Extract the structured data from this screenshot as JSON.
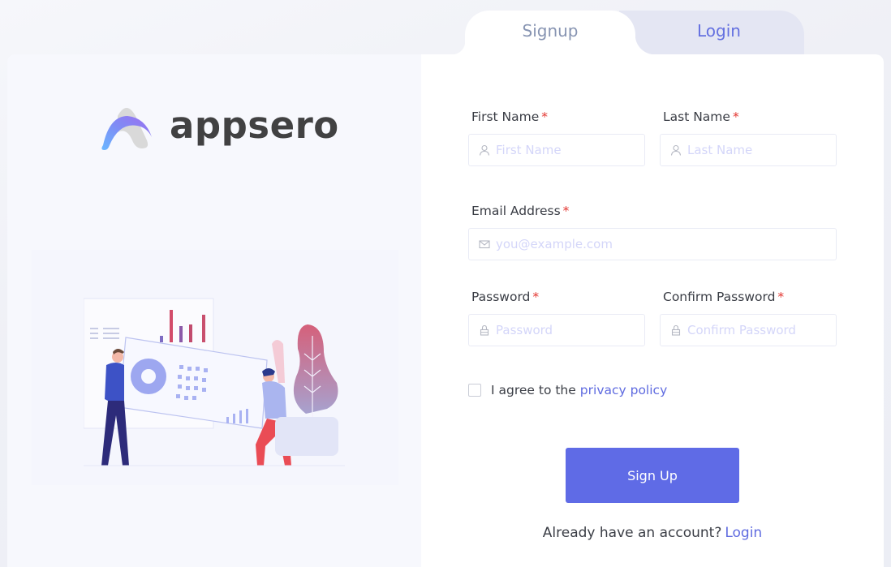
{
  "tabs": {
    "signup": "Signup",
    "login": "Login",
    "active": "Signup"
  },
  "brand": {
    "name": "appsero",
    "logo_icon": "appsero-arc-logo"
  },
  "illustration": {
    "description": "two-people-holding-dashboard-illustration"
  },
  "form": {
    "first_name": {
      "label": "First Name",
      "required": "*",
      "placeholder": "First Name",
      "value": "",
      "icon": "user-icon"
    },
    "last_name": {
      "label": "Last Name",
      "required": "*",
      "placeholder": "Last Name",
      "value": "",
      "icon": "user-icon"
    },
    "email": {
      "label": "Email Address",
      "required": "*",
      "placeholder": "you@example.com",
      "value": "",
      "icon": "envelope-icon"
    },
    "password": {
      "label": "Password",
      "required": "*",
      "placeholder": "Password",
      "value": "",
      "icon": "lock-icon"
    },
    "confirm_password": {
      "label": "Confirm Password",
      "required": "*",
      "placeholder": "Confirm Password",
      "value": "",
      "icon": "lock-icon"
    },
    "agree": {
      "text": "I agree to the",
      "link": "privacy policy",
      "checked": false
    },
    "submit_label": "Sign Up",
    "footer": {
      "text": "Already have an account?",
      "link": "Login"
    }
  },
  "colors": {
    "accent": "#5f6be6",
    "link": "#5f6be0",
    "required": "#e3342f",
    "placeholder": "#d4d6f9",
    "tab_inactive_bg": "#e4e6f3",
    "left_panel_bg": "#f7f8fd"
  }
}
